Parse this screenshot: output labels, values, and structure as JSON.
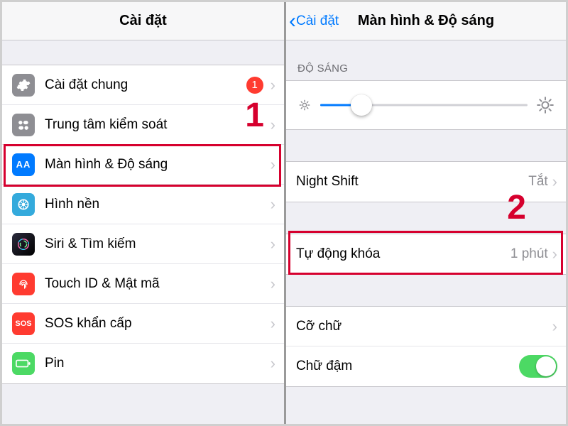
{
  "left": {
    "title": "Cài đặt",
    "items": [
      {
        "label": "Cài đặt chung",
        "badge": "1",
        "icon": "gear"
      },
      {
        "label": "Trung tâm kiểm soát",
        "icon": "control"
      },
      {
        "label": "Màn hình & Độ sáng",
        "icon": "display"
      },
      {
        "label": "Hình nền",
        "icon": "wallpaper"
      },
      {
        "label": "Siri & Tìm kiếm",
        "icon": "siri"
      },
      {
        "label": "Touch ID & Mật mã",
        "icon": "touchid"
      },
      {
        "label": "SOS khẩn cấp",
        "icon": "sos"
      },
      {
        "label": "Pin",
        "icon": "battery"
      }
    ],
    "step_number": "1"
  },
  "right": {
    "back_label": "Cài đặt",
    "title": "Màn hình & Độ sáng",
    "brightness_header": "ĐỘ SÁNG",
    "night_shift": {
      "label": "Night Shift",
      "value": "Tắt"
    },
    "auto_lock": {
      "label": "Tự động khóa",
      "value": "1 phút"
    },
    "text_size": {
      "label": "Cỡ chữ"
    },
    "bold_text": {
      "label": "Chữ đậm",
      "on": true
    },
    "step_number": "2"
  }
}
